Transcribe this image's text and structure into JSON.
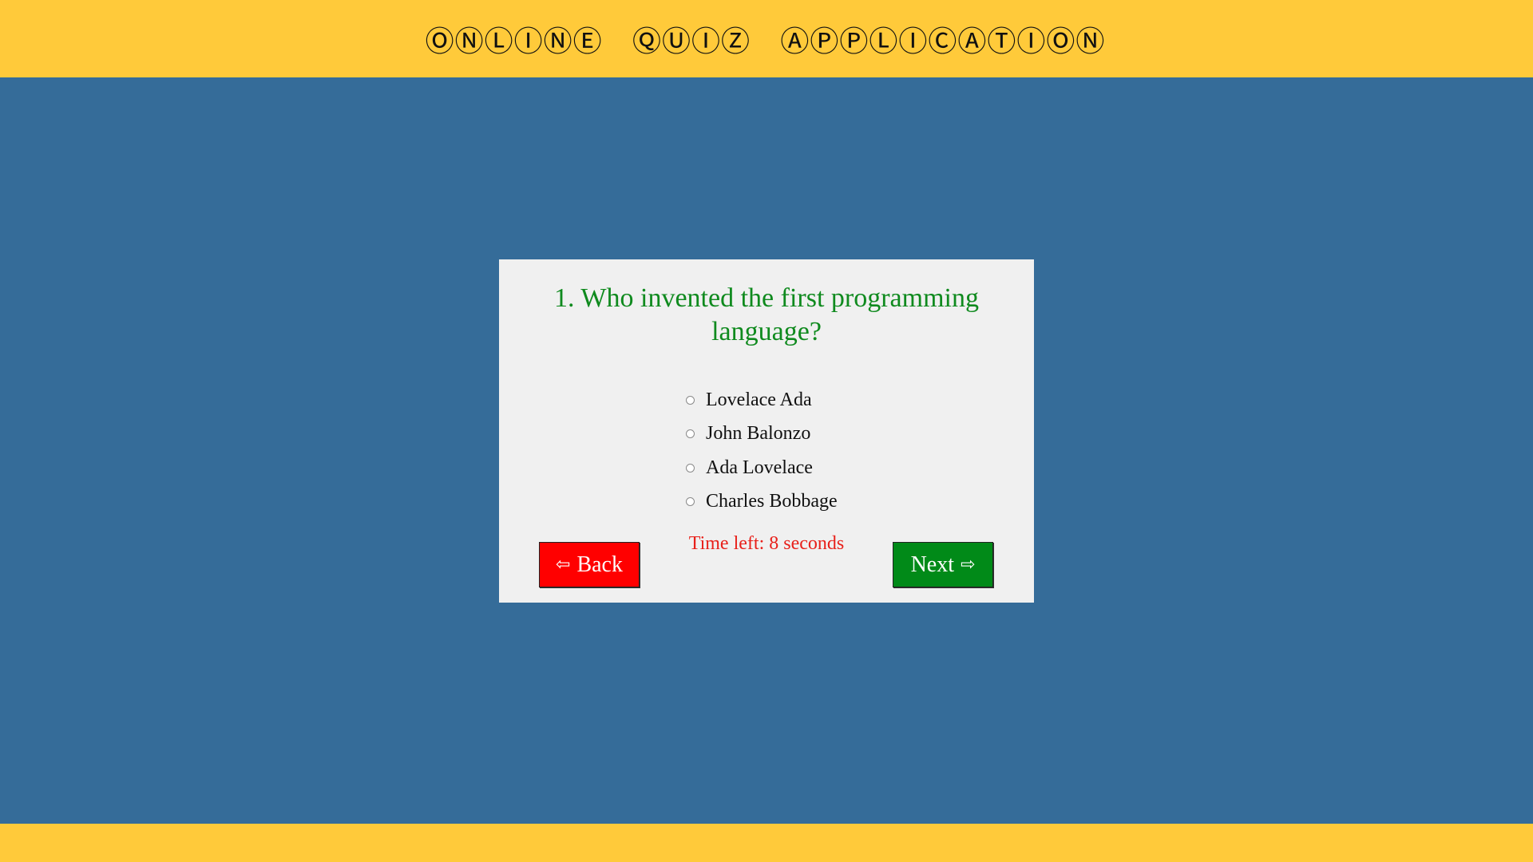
{
  "header": {
    "title": "ⓄⓃⓁⒾⓃⒺ   ⓆⓊⒾⓏ   ⒶⓅⓅⓁⒾⒸⒶⓉⒾⓄⓃ"
  },
  "quiz": {
    "question": "1. Who invented the first programming language?",
    "options": [
      {
        "label": "Lovelace Ada"
      },
      {
        "label": "John Balonzo"
      },
      {
        "label": "Ada Lovelace"
      },
      {
        "label": "Charles Bobbage"
      }
    ],
    "timer_text": "Time left: 8 seconds"
  },
  "buttons": {
    "back_label": "Back",
    "back_arrow": "⇦",
    "next_label": "Next",
    "next_arrow": "⇨"
  },
  "colors": {
    "background": "#356c99",
    "header": "#ffca3a",
    "question": "#0f8a1e",
    "timer": "#e8201a",
    "back_button": "#ff0000",
    "next_button": "#018a18"
  }
}
